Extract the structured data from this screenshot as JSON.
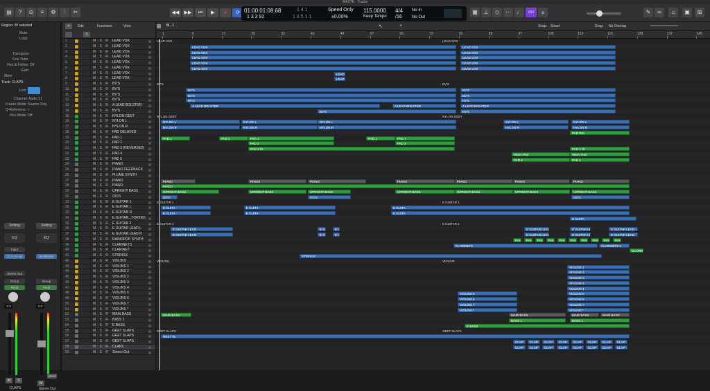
{
  "window": {
    "title": "WASTE - Tracks"
  },
  "control_bar": {
    "position_time": "01:00:01:08.68",
    "position_bars": "1 3 3  92",
    "end_a": "1 4 1",
    "end_b": "1 3 5 1 1",
    "mode": "Speed Only",
    "mode_percent": "±0.00%",
    "tempo": "115.0000",
    "tempo_mode": "Keep Tempo",
    "signature": "4/4",
    "division": "/16",
    "in_label": "No In",
    "out_label": "No Out",
    "cpu_label": "d34"
  },
  "inspector": {
    "region_header": "Region: 30 selected",
    "rows": [
      "Mute:",
      "Loop:",
      "Transpose:",
      "Fine Tune:",
      "Flex & Follow: Off",
      "Gain:",
      "More"
    ],
    "track_header": "Track: CLAPS",
    "track_rows": [
      "Icon:",
      "Channel: Audio 31",
      "Freeze Mode: Source Only",
      "Q-Reference: ✓",
      "Flex Mode: Off"
    ],
    "strip1": {
      "setting": "Setting",
      "eq": "EQ",
      "input": "Input",
      "plugin": "CLA-2A (s)",
      "send": "Stereo Out",
      "group": "Group",
      "read": "Read",
      "value": "-2.6",
      "name": "CLAPS"
    },
    "strip2": {
      "setting": "Setting",
      "eq": "EQ",
      "plugin": "MultiMeter",
      "group": "Group",
      "read": "Read",
      "value": "0.0",
      "name": "Stereo Out",
      "bnce": "Bnce"
    }
  },
  "menus": {
    "edit": "Edit",
    "functions": "Functions",
    "view": "View",
    "snap_label": "Snap:",
    "snap_value": "Smart",
    "drag_label": "Drag:",
    "drag_value": "No Overlap"
  },
  "ruler": [
    "1",
    "9",
    "17",
    "25",
    "33",
    "41",
    "49",
    "57",
    "65",
    "73",
    "81",
    "89",
    "97",
    "105",
    "113",
    "121",
    "129",
    "137",
    "145"
  ],
  "ruler_marker": "M...1",
  "tracks": [
    {
      "n": "1",
      "name": "LEAD VOX"
    },
    {
      "n": "2",
      "name": "LEAD VOX"
    },
    {
      "n": "3",
      "name": "LEAD VOX"
    },
    {
      "n": "4",
      "name": "LEAD VOX"
    },
    {
      "n": "5",
      "name": "LEAD VOX"
    },
    {
      "n": "6",
      "name": "LEAD VOX"
    },
    {
      "n": "7",
      "name": "LEAD VOX"
    },
    {
      "n": "8",
      "name": "LEAD VOX"
    },
    {
      "n": "9",
      "name": "BV'S"
    },
    {
      "n": "10",
      "name": "BV'S"
    },
    {
      "n": "11",
      "name": "BV'S"
    },
    {
      "n": "12",
      "name": "BV'S"
    },
    {
      "n": "13",
      "name": "A LEAD BOLSTER"
    },
    {
      "n": "14",
      "name": "BV'S"
    },
    {
      "n": "15",
      "name": "NYLON GEET"
    },
    {
      "n": "16",
      "name": "NYLON L"
    },
    {
      "n": "17",
      "name": "NYLON R"
    },
    {
      "n": "18",
      "name": "PAD DELAYED"
    },
    {
      "n": "19",
      "name": "PAD 1"
    },
    {
      "n": "20",
      "name": "PAD 2"
    },
    {
      "n": "21",
      "name": "PAD 3 (REVERSED)"
    },
    {
      "n": "22",
      "name": "PAD 4"
    },
    {
      "n": "23",
      "name": "PAD 5"
    },
    {
      "n": "24",
      "name": "PIANO"
    },
    {
      "n": "25",
      "name": "PIANO FEEDBACK"
    },
    {
      "n": "26",
      "name": "FLUME SYNTH"
    },
    {
      "n": "27",
      "name": "PIANO"
    },
    {
      "n": "28",
      "name": "PIANO"
    },
    {
      "n": "29",
      "name": "UPRIGHT BASS"
    },
    {
      "n": "30",
      "name": "OO'S"
    },
    {
      "n": "31",
      "name": "E GUITAR 1"
    },
    {
      "n": "32",
      "name": "E GUITAR L"
    },
    {
      "n": "33",
      "name": "E GUITAR R"
    },
    {
      "n": "34",
      "name": "E GUITAR...TORTED"
    },
    {
      "n": "35",
      "name": "E GUITAR 2"
    },
    {
      "n": "36",
      "name": "E GUITAR LEAD L"
    },
    {
      "n": "37",
      "name": "E GUITAR LEAD R"
    },
    {
      "n": "38",
      "name": "RAINDROP SYNTH"
    },
    {
      "n": "39",
      "name": "CLARINETS"
    },
    {
      "n": "40",
      "name": "CLARINET"
    },
    {
      "n": "41",
      "name": "STRINGS"
    },
    {
      "n": "42",
      "name": "VIOLINS"
    },
    {
      "n": "43",
      "name": "VIOLINS 1"
    },
    {
      "n": "44",
      "name": "VIOLINS 2"
    },
    {
      "n": "45",
      "name": "VIOLINS 2"
    },
    {
      "n": "46",
      "name": "VIOLINS 3"
    },
    {
      "n": "47",
      "name": "VIOLINS 4"
    },
    {
      "n": "48",
      "name": "VIOLINS 5"
    },
    {
      "n": "49",
      "name": "VIOLINS 6"
    },
    {
      "n": "50",
      "name": "VIOLINS 7"
    },
    {
      "n": "51",
      "name": "VIOLINS *"
    },
    {
      "n": "52",
      "name": "MAIN BASS"
    },
    {
      "n": "53",
      "name": "BASS 1"
    },
    {
      "n": "54",
      "name": "E BASS"
    },
    {
      "n": "55",
      "name": "GEET SLAPS"
    },
    {
      "n": "56",
      "name": "GEET SLAPS"
    },
    {
      "n": "57",
      "name": "GEET SLAPS"
    },
    {
      "n": "58",
      "name": "CLAPS"
    },
    {
      "n": "59",
      "name": "Stereo Out"
    }
  ],
  "track_controls": "M S R",
  "region_labels": {
    "lead_vox": "LEAD VOX",
    "bvs": "BV'S",
    "bolster": "A LEAD BOLSTER",
    "nylon_geet": "NYLON GEET",
    "nylon_l": "NYLON L",
    "nylon_r": "NYLON R",
    "pad1": "PAD 1",
    "pad2": "PAD 2",
    "pad3": "PAD 3 (R",
    "pad4": "PAD 4",
    "warm": "Warm Pad",
    "pad_del": "PAD DEL",
    "piano": "PIANO",
    "upright": "UPRIGHT BASS",
    "oos": "OO'S",
    "eg1": "E GUITAR 1",
    "egl": "E GUITA",
    "eg2": "E GUITAR 2",
    "eglead": "E GUITAR LEAD",
    "rain": "RAI",
    "clarinets": "CLARINETS",
    "clarinet": "CLARINETS 1",
    "clarinet_end": "CLARINE",
    "strings": "STRINGS",
    "violins": "VIOLINS",
    "v1": "VIOLINS 1",
    "v2": "VIOLINS 2",
    "v3": "VIOLINS 3",
    "v4": "VIOLINS 4",
    "v5": "VIOLINS 5",
    "v6": "VIOLINS 6",
    "v7": "VIOLINS 7",
    "vstar": "VIOLINS *",
    "mainbass": "MAIN BASS",
    "bass1": "BASS 1",
    "ebass": "E BASS",
    "geet": "GEET SLAPS",
    "geet_s": "GEET SL",
    "clap": "CLAP"
  }
}
